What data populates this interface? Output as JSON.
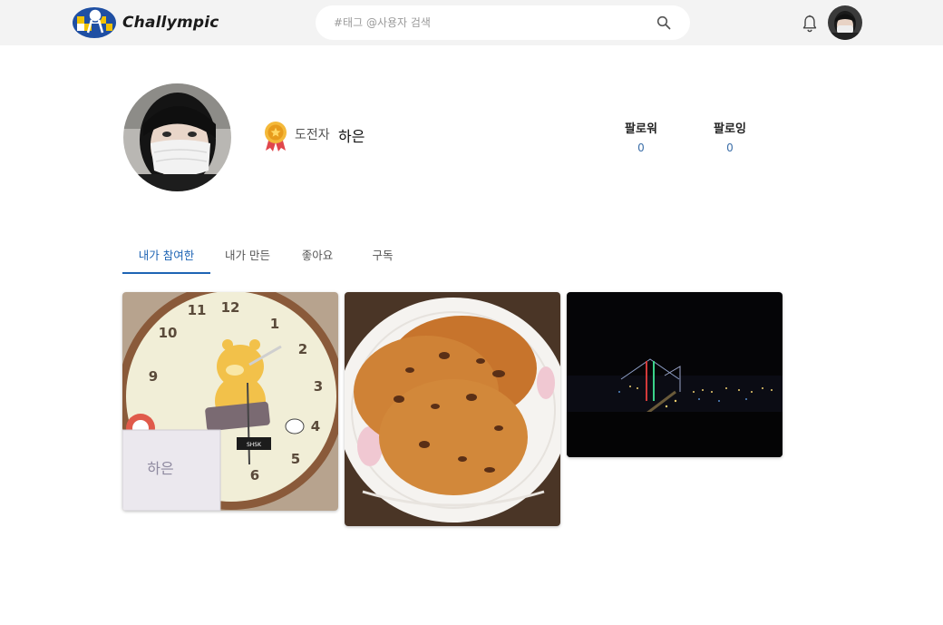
{
  "header": {
    "brand": "Challympic",
    "search_placeholder": "#태그 @사용자 검색"
  },
  "profile": {
    "rank": "도전자",
    "username": "하은",
    "followers_label": "팔로워",
    "followers_count": "0",
    "following_label": "팔로잉",
    "following_count": "0"
  },
  "tabs": [
    {
      "label": "내가 참여한",
      "active": true
    },
    {
      "label": "내가 만든",
      "active": false
    },
    {
      "label": "좋아요",
      "active": false
    },
    {
      "label": "구독",
      "active": false
    }
  ],
  "posts": [
    {
      "subject": "clock-with-name-card",
      "card_text": "하은"
    },
    {
      "subject": "chocolate-chip-cookies"
    },
    {
      "subject": "night-bridge-cityscape"
    }
  ],
  "colors": {
    "accent": "#1e64b4",
    "header_bg": "#f3f3f3",
    "count_color": "#3b6ea8"
  },
  "icons": {
    "search": "search-icon",
    "notification": "bell-icon",
    "rank_badge": "medal-icon"
  }
}
